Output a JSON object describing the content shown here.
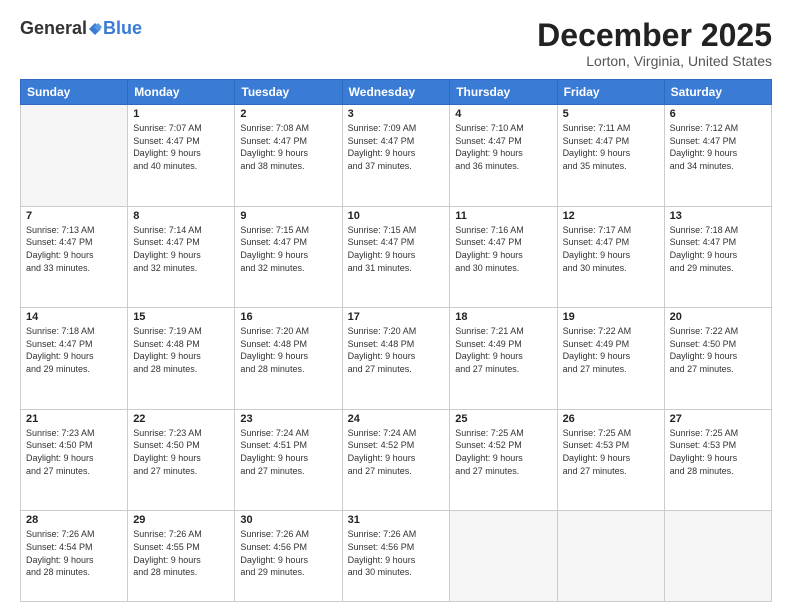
{
  "header": {
    "logo_general": "General",
    "logo_blue": "Blue",
    "month_title": "December 2025",
    "location": "Lorton, Virginia, United States"
  },
  "weekdays": [
    "Sunday",
    "Monday",
    "Tuesday",
    "Wednesday",
    "Thursday",
    "Friday",
    "Saturday"
  ],
  "weeks": [
    [
      {
        "day": "",
        "info": ""
      },
      {
        "day": "1",
        "info": "Sunrise: 7:07 AM\nSunset: 4:47 PM\nDaylight: 9 hours\nand 40 minutes."
      },
      {
        "day": "2",
        "info": "Sunrise: 7:08 AM\nSunset: 4:47 PM\nDaylight: 9 hours\nand 38 minutes."
      },
      {
        "day": "3",
        "info": "Sunrise: 7:09 AM\nSunset: 4:47 PM\nDaylight: 9 hours\nand 37 minutes."
      },
      {
        "day": "4",
        "info": "Sunrise: 7:10 AM\nSunset: 4:47 PM\nDaylight: 9 hours\nand 36 minutes."
      },
      {
        "day": "5",
        "info": "Sunrise: 7:11 AM\nSunset: 4:47 PM\nDaylight: 9 hours\nand 35 minutes."
      },
      {
        "day": "6",
        "info": "Sunrise: 7:12 AM\nSunset: 4:47 PM\nDaylight: 9 hours\nand 34 minutes."
      }
    ],
    [
      {
        "day": "7",
        "info": "Sunrise: 7:13 AM\nSunset: 4:47 PM\nDaylight: 9 hours\nand 33 minutes."
      },
      {
        "day": "8",
        "info": "Sunrise: 7:14 AM\nSunset: 4:47 PM\nDaylight: 9 hours\nand 32 minutes."
      },
      {
        "day": "9",
        "info": "Sunrise: 7:15 AM\nSunset: 4:47 PM\nDaylight: 9 hours\nand 32 minutes."
      },
      {
        "day": "10",
        "info": "Sunrise: 7:15 AM\nSunset: 4:47 PM\nDaylight: 9 hours\nand 31 minutes."
      },
      {
        "day": "11",
        "info": "Sunrise: 7:16 AM\nSunset: 4:47 PM\nDaylight: 9 hours\nand 30 minutes."
      },
      {
        "day": "12",
        "info": "Sunrise: 7:17 AM\nSunset: 4:47 PM\nDaylight: 9 hours\nand 30 minutes."
      },
      {
        "day": "13",
        "info": "Sunrise: 7:18 AM\nSunset: 4:47 PM\nDaylight: 9 hours\nand 29 minutes."
      }
    ],
    [
      {
        "day": "14",
        "info": "Sunrise: 7:18 AM\nSunset: 4:47 PM\nDaylight: 9 hours\nand 29 minutes."
      },
      {
        "day": "15",
        "info": "Sunrise: 7:19 AM\nSunset: 4:48 PM\nDaylight: 9 hours\nand 28 minutes."
      },
      {
        "day": "16",
        "info": "Sunrise: 7:20 AM\nSunset: 4:48 PM\nDaylight: 9 hours\nand 28 minutes."
      },
      {
        "day": "17",
        "info": "Sunrise: 7:20 AM\nSunset: 4:48 PM\nDaylight: 9 hours\nand 27 minutes."
      },
      {
        "day": "18",
        "info": "Sunrise: 7:21 AM\nSunset: 4:49 PM\nDaylight: 9 hours\nand 27 minutes."
      },
      {
        "day": "19",
        "info": "Sunrise: 7:22 AM\nSunset: 4:49 PM\nDaylight: 9 hours\nand 27 minutes."
      },
      {
        "day": "20",
        "info": "Sunrise: 7:22 AM\nSunset: 4:50 PM\nDaylight: 9 hours\nand 27 minutes."
      }
    ],
    [
      {
        "day": "21",
        "info": "Sunrise: 7:23 AM\nSunset: 4:50 PM\nDaylight: 9 hours\nand 27 minutes."
      },
      {
        "day": "22",
        "info": "Sunrise: 7:23 AM\nSunset: 4:50 PM\nDaylight: 9 hours\nand 27 minutes."
      },
      {
        "day": "23",
        "info": "Sunrise: 7:24 AM\nSunset: 4:51 PM\nDaylight: 9 hours\nand 27 minutes."
      },
      {
        "day": "24",
        "info": "Sunrise: 7:24 AM\nSunset: 4:52 PM\nDaylight: 9 hours\nand 27 minutes."
      },
      {
        "day": "25",
        "info": "Sunrise: 7:25 AM\nSunset: 4:52 PM\nDaylight: 9 hours\nand 27 minutes."
      },
      {
        "day": "26",
        "info": "Sunrise: 7:25 AM\nSunset: 4:53 PM\nDaylight: 9 hours\nand 27 minutes."
      },
      {
        "day": "27",
        "info": "Sunrise: 7:25 AM\nSunset: 4:53 PM\nDaylight: 9 hours\nand 28 minutes."
      }
    ],
    [
      {
        "day": "28",
        "info": "Sunrise: 7:26 AM\nSunset: 4:54 PM\nDaylight: 9 hours\nand 28 minutes."
      },
      {
        "day": "29",
        "info": "Sunrise: 7:26 AM\nSunset: 4:55 PM\nDaylight: 9 hours\nand 28 minutes."
      },
      {
        "day": "30",
        "info": "Sunrise: 7:26 AM\nSunset: 4:56 PM\nDaylight: 9 hours\nand 29 minutes."
      },
      {
        "day": "31",
        "info": "Sunrise: 7:26 AM\nSunset: 4:56 PM\nDaylight: 9 hours\nand 30 minutes."
      },
      {
        "day": "",
        "info": ""
      },
      {
        "day": "",
        "info": ""
      },
      {
        "day": "",
        "info": ""
      }
    ]
  ]
}
